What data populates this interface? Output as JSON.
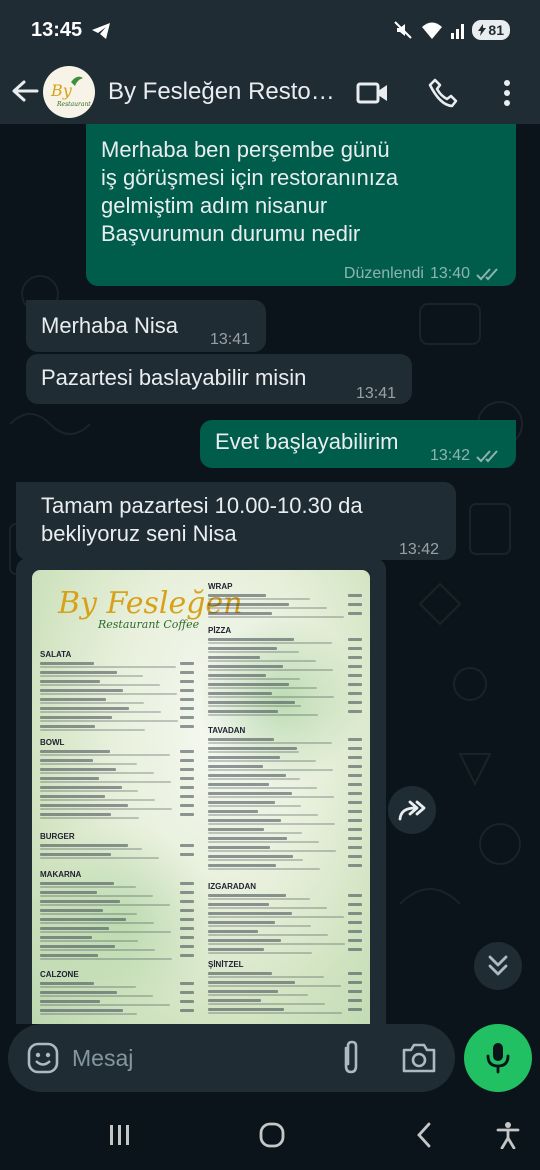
{
  "status_bar": {
    "time": "13:45",
    "battery": "81"
  },
  "header": {
    "contact_name": "By Fesleğen Resto…",
    "back_icon": "arrow-left-icon",
    "video_icon": "video-call-icon",
    "call_icon": "phone-icon",
    "menu_icon": "more-vert-icon"
  },
  "messages": [
    {
      "direction": "out",
      "text": "Merhaba ben perşembe günü\niş görüşmesi için restoranınıza\ngelmiştim adım nisanur\nBaşvurumun durumu nedir",
      "edited": "Düzenlendi",
      "time": "13:40"
    },
    {
      "direction": "in",
      "text": "Merhaba Nisa",
      "time": "13:41"
    },
    {
      "direction": "in",
      "text": "Pazartesi baslayabilir misin",
      "time": "13:41"
    },
    {
      "direction": "out",
      "text": "Evet başlayabilirim",
      "time": "13:42"
    },
    {
      "direction": "in",
      "text": "Tamam pazartesi 10.00-10.30 da\nbekliyoruz seni Nisa",
      "time": "13:42"
    }
  ],
  "image_message": {
    "logo": "By Fesleğen",
    "logo_sub": "Restaurant Coffee",
    "left_sections": [
      "SALATA",
      "BOWL",
      "BURGER",
      "MAKARNA",
      "CALZONE"
    ],
    "right_sections": [
      "WRAP",
      "PİZZA",
      "TAVADAN",
      "IZGARADAN",
      "ŞİNİTZEL"
    ]
  },
  "composer": {
    "placeholder": "Mesaj"
  },
  "colors": {
    "outgoing": "#005c4b",
    "incoming": "#1f2c34",
    "accent": "#21c063",
    "background": "#0b141a"
  }
}
